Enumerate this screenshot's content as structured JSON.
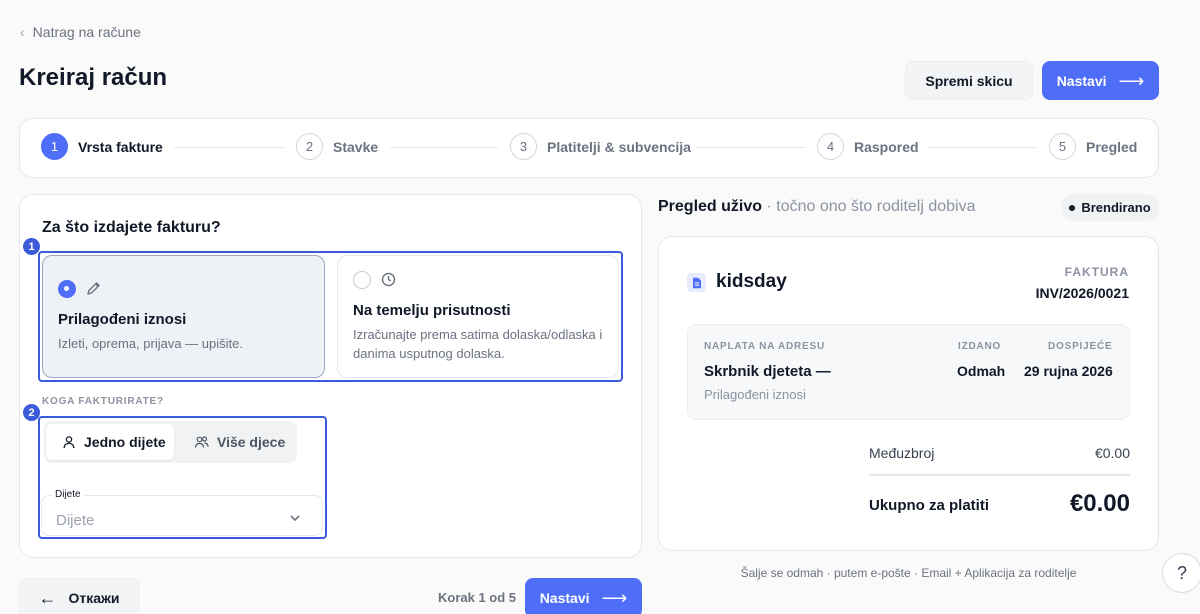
{
  "back_link": {
    "label": "Natrag na račune"
  },
  "header": {
    "title": "Kreiraj račun",
    "save_draft_label": "Spremi skicu",
    "next_label": "Nastavi"
  },
  "stepper": {
    "steps": [
      {
        "number": "1",
        "label": "Vrsta fakture",
        "active": true
      },
      {
        "number": "2",
        "label": "Stavke",
        "active": false
      },
      {
        "number": "3",
        "label": "Platitelji & subvencija",
        "active": false
      },
      {
        "number": "4",
        "label": "Raspored",
        "active": false
      },
      {
        "number": "5",
        "label": "Pregled",
        "active": false
      }
    ]
  },
  "form": {
    "question": "Za što izdajete fakturu?",
    "markers": [
      "1",
      "2"
    ],
    "invoice_types": [
      {
        "title": "Prilagođeni iznosi",
        "description": "Izleti, oprema, prijava — upišite.",
        "selected": true,
        "icon": "pencil-icon"
      },
      {
        "title": "Na temelju prisutnosti",
        "description": "Izračunajte prema satima dolaska/odlaska i danima usputnog dolaska.",
        "selected": false,
        "icon": "clock-icon"
      }
    ],
    "billing_target": {
      "label": "KOGA FAKTURIRATE?",
      "options": [
        {
          "label": "Jedno dijete",
          "selected": true,
          "icon": "person-icon"
        },
        {
          "label": "Više djece",
          "selected": false,
          "icon": "people-icon"
        }
      ]
    },
    "child_select": {
      "legend": "Dijete",
      "value": "Dijete"
    }
  },
  "footer": {
    "cancel_label": "Откажи",
    "step_counter": "Korak 1 od 5",
    "next_label": "Nastavi"
  },
  "preview": {
    "title": "Pregled uživo",
    "subtitle": " · točno ono što roditelj dobiva",
    "badge": "Brendirano",
    "invoice": {
      "brand": "kidsday",
      "doc_type": "FAKTURA",
      "doc_number": "INV/2026/0021",
      "billing_caption": "NAPLATA NA ADRESU",
      "billing_name": "Skrbnik djeteta —",
      "billing_sub": "Prilagođeni iznosi",
      "issued_caption": "IZDANO",
      "issued_value": "Odmah",
      "due_caption": "DOSPIJEĆE",
      "due_value": "29 rujna 2026",
      "subtotal_label": "Međuzbroj",
      "subtotal_value": "€0.00",
      "total_label": "Ukupno za platiti",
      "total_value": "€0.00"
    },
    "delivery_note": "Šalje se odmah · putem e-pošte · Email + Aplikacija za roditelje"
  },
  "help": {
    "label": "?"
  },
  "colors": {
    "accent": "#4f6ef7",
    "marker": "#3b5bdb"
  }
}
